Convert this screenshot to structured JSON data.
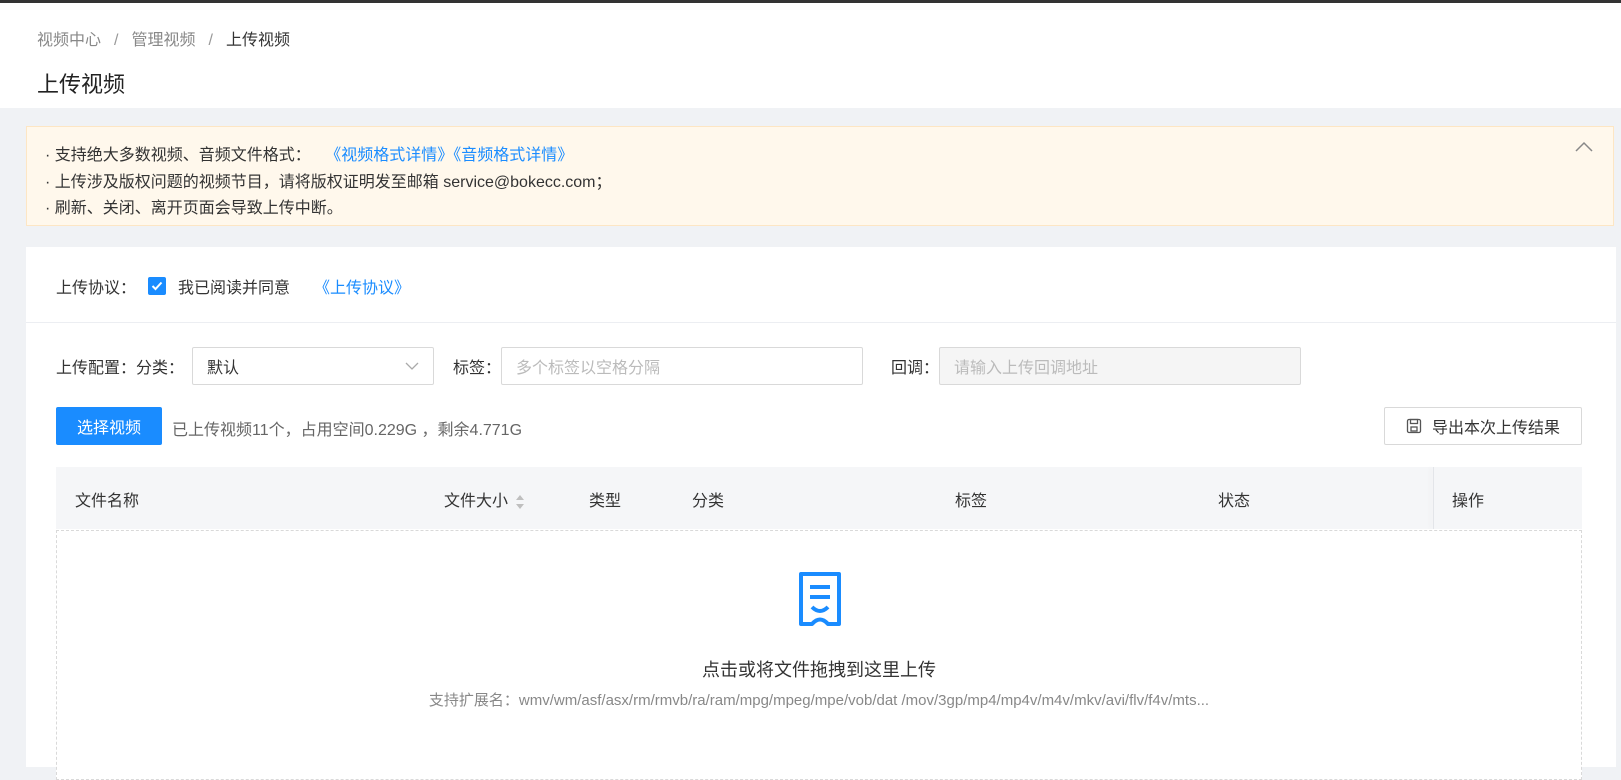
{
  "breadcrumb": [
    "视频中心",
    "管理视频",
    "上传视频"
  ],
  "page_title": "上传视频",
  "notice": {
    "line1_text": "· 支持绝大多数视频、音频文件格式：",
    "video_format_link": "《视频格式详情》",
    "audio_format_link": "《音频格式详情》",
    "line2_text": "· 上传涉及版权问题的视频节目，请将版权证明发至邮箱 service@bokecc.com；",
    "line3_text": "· 刷新、关闭、离开页面会导致上传中断。"
  },
  "agreement": {
    "label": "上传协议：",
    "checkbox_label": "我已阅读并同意",
    "checked": true,
    "link": "《上传协议》"
  },
  "config": {
    "label": "上传配置：",
    "category_label": "分类：",
    "category_value": "默认",
    "tags_label": "标签：",
    "tags_placeholder": "多个标签以空格分隔",
    "callback_label": "回调：",
    "callback_placeholder": "请输入上传回调地址"
  },
  "actions": {
    "select_video": "选择视频",
    "usage": "已上传视频11个，占用空间0.229G ，剩余4.771G",
    "export": "导出本次上传结果"
  },
  "table": {
    "columns": [
      "文件名称",
      "文件大小",
      "类型",
      "分类",
      "标签",
      "状态",
      "操作"
    ]
  },
  "dropzone": {
    "title": "点击或将文件拖拽到这里上传",
    "extensions": "支持扩展名：wmv/wm/asf/asx/rm/rmvb/ra/ram/mpg/mpeg/mpe/vob/dat /mov/3gp/mp4/mp4v/m4v/mkv/avi/flv/f4v/mts..."
  },
  "colors": {
    "primary": "#1a8cff",
    "notice_bg": "#fff8ec"
  }
}
